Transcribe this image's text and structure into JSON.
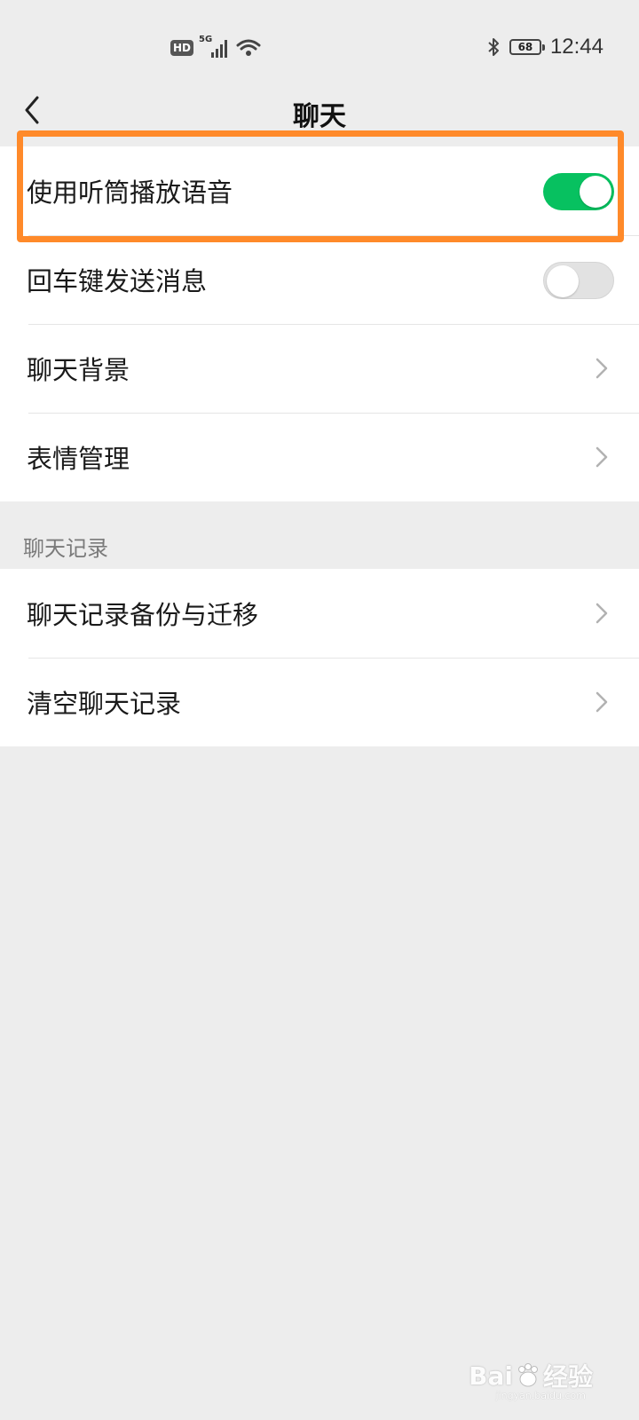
{
  "status_bar": {
    "hd_badge": "HD",
    "network": "5G",
    "battery_level": "68",
    "time": "12:44",
    "icons": [
      "hd-icon",
      "signal-icon",
      "wifi-icon",
      "bluetooth-icon",
      "battery-icon"
    ]
  },
  "header": {
    "title": "聊天",
    "back_icon": "chevron-left-icon"
  },
  "settings_group_1": {
    "items": [
      {
        "label": "使用听筒播放语音",
        "control": "toggle",
        "state": "on"
      },
      {
        "label": "回车键发送消息",
        "control": "toggle",
        "state": "off"
      },
      {
        "label": "聊天背景",
        "control": "chevron"
      },
      {
        "label": "表情管理",
        "control": "chevron"
      }
    ]
  },
  "section_chat_history": {
    "header": "聊天记录",
    "items": [
      {
        "label": "聊天记录备份与迁移",
        "control": "chevron"
      },
      {
        "label": "清空聊天记录",
        "control": "chevron"
      }
    ]
  },
  "watermark": {
    "brand": "Bai",
    "brand_suffix": "经验",
    "url": "jingyan.baidu.com"
  },
  "colors": {
    "toggle_on": "#07c160",
    "highlight": "#ff8a2a",
    "background": "#ededed"
  }
}
